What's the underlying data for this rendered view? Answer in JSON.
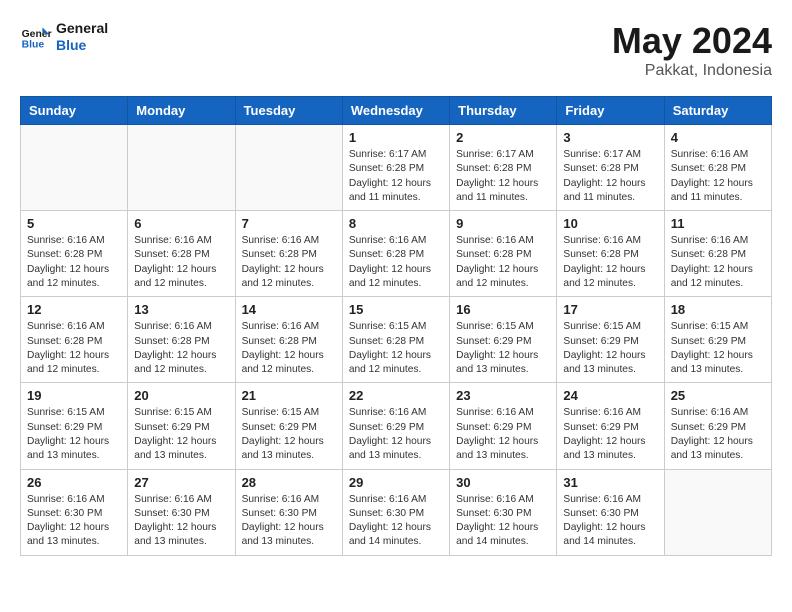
{
  "header": {
    "logo_line1": "General",
    "logo_line2": "Blue",
    "main_title": "May 2024",
    "subtitle": "Pakkat, Indonesia"
  },
  "weekdays": [
    "Sunday",
    "Monday",
    "Tuesday",
    "Wednesday",
    "Thursday",
    "Friday",
    "Saturday"
  ],
  "weeks": [
    [
      {
        "day": "",
        "content": ""
      },
      {
        "day": "",
        "content": ""
      },
      {
        "day": "",
        "content": ""
      },
      {
        "day": "1",
        "content": "Sunrise: 6:17 AM\nSunset: 6:28 PM\nDaylight: 12 hours\nand 11 minutes."
      },
      {
        "day": "2",
        "content": "Sunrise: 6:17 AM\nSunset: 6:28 PM\nDaylight: 12 hours\nand 11 minutes."
      },
      {
        "day": "3",
        "content": "Sunrise: 6:17 AM\nSunset: 6:28 PM\nDaylight: 12 hours\nand 11 minutes."
      },
      {
        "day": "4",
        "content": "Sunrise: 6:16 AM\nSunset: 6:28 PM\nDaylight: 12 hours\nand 11 minutes."
      }
    ],
    [
      {
        "day": "5",
        "content": "Sunrise: 6:16 AM\nSunset: 6:28 PM\nDaylight: 12 hours\nand 12 minutes."
      },
      {
        "day": "6",
        "content": "Sunrise: 6:16 AM\nSunset: 6:28 PM\nDaylight: 12 hours\nand 12 minutes."
      },
      {
        "day": "7",
        "content": "Sunrise: 6:16 AM\nSunset: 6:28 PM\nDaylight: 12 hours\nand 12 minutes."
      },
      {
        "day": "8",
        "content": "Sunrise: 6:16 AM\nSunset: 6:28 PM\nDaylight: 12 hours\nand 12 minutes."
      },
      {
        "day": "9",
        "content": "Sunrise: 6:16 AM\nSunset: 6:28 PM\nDaylight: 12 hours\nand 12 minutes."
      },
      {
        "day": "10",
        "content": "Sunrise: 6:16 AM\nSunset: 6:28 PM\nDaylight: 12 hours\nand 12 minutes."
      },
      {
        "day": "11",
        "content": "Sunrise: 6:16 AM\nSunset: 6:28 PM\nDaylight: 12 hours\nand 12 minutes."
      }
    ],
    [
      {
        "day": "12",
        "content": "Sunrise: 6:16 AM\nSunset: 6:28 PM\nDaylight: 12 hours\nand 12 minutes."
      },
      {
        "day": "13",
        "content": "Sunrise: 6:16 AM\nSunset: 6:28 PM\nDaylight: 12 hours\nand 12 minutes."
      },
      {
        "day": "14",
        "content": "Sunrise: 6:16 AM\nSunset: 6:28 PM\nDaylight: 12 hours\nand 12 minutes."
      },
      {
        "day": "15",
        "content": "Sunrise: 6:15 AM\nSunset: 6:28 PM\nDaylight: 12 hours\nand 12 minutes."
      },
      {
        "day": "16",
        "content": "Sunrise: 6:15 AM\nSunset: 6:29 PM\nDaylight: 12 hours\nand 13 minutes."
      },
      {
        "day": "17",
        "content": "Sunrise: 6:15 AM\nSunset: 6:29 PM\nDaylight: 12 hours\nand 13 minutes."
      },
      {
        "day": "18",
        "content": "Sunrise: 6:15 AM\nSunset: 6:29 PM\nDaylight: 12 hours\nand 13 minutes."
      }
    ],
    [
      {
        "day": "19",
        "content": "Sunrise: 6:15 AM\nSunset: 6:29 PM\nDaylight: 12 hours\nand 13 minutes."
      },
      {
        "day": "20",
        "content": "Sunrise: 6:15 AM\nSunset: 6:29 PM\nDaylight: 12 hours\nand 13 minutes."
      },
      {
        "day": "21",
        "content": "Sunrise: 6:15 AM\nSunset: 6:29 PM\nDaylight: 12 hours\nand 13 minutes."
      },
      {
        "day": "22",
        "content": "Sunrise: 6:16 AM\nSunset: 6:29 PM\nDaylight: 12 hours\nand 13 minutes."
      },
      {
        "day": "23",
        "content": "Sunrise: 6:16 AM\nSunset: 6:29 PM\nDaylight: 12 hours\nand 13 minutes."
      },
      {
        "day": "24",
        "content": "Sunrise: 6:16 AM\nSunset: 6:29 PM\nDaylight: 12 hours\nand 13 minutes."
      },
      {
        "day": "25",
        "content": "Sunrise: 6:16 AM\nSunset: 6:29 PM\nDaylight: 12 hours\nand 13 minutes."
      }
    ],
    [
      {
        "day": "26",
        "content": "Sunrise: 6:16 AM\nSunset: 6:30 PM\nDaylight: 12 hours\nand 13 minutes."
      },
      {
        "day": "27",
        "content": "Sunrise: 6:16 AM\nSunset: 6:30 PM\nDaylight: 12 hours\nand 13 minutes."
      },
      {
        "day": "28",
        "content": "Sunrise: 6:16 AM\nSunset: 6:30 PM\nDaylight: 12 hours\nand 13 minutes."
      },
      {
        "day": "29",
        "content": "Sunrise: 6:16 AM\nSunset: 6:30 PM\nDaylight: 12 hours\nand 14 minutes."
      },
      {
        "day": "30",
        "content": "Sunrise: 6:16 AM\nSunset: 6:30 PM\nDaylight: 12 hours\nand 14 minutes."
      },
      {
        "day": "31",
        "content": "Sunrise: 6:16 AM\nSunset: 6:30 PM\nDaylight: 12 hours\nand 14 minutes."
      },
      {
        "day": "",
        "content": ""
      }
    ]
  ]
}
